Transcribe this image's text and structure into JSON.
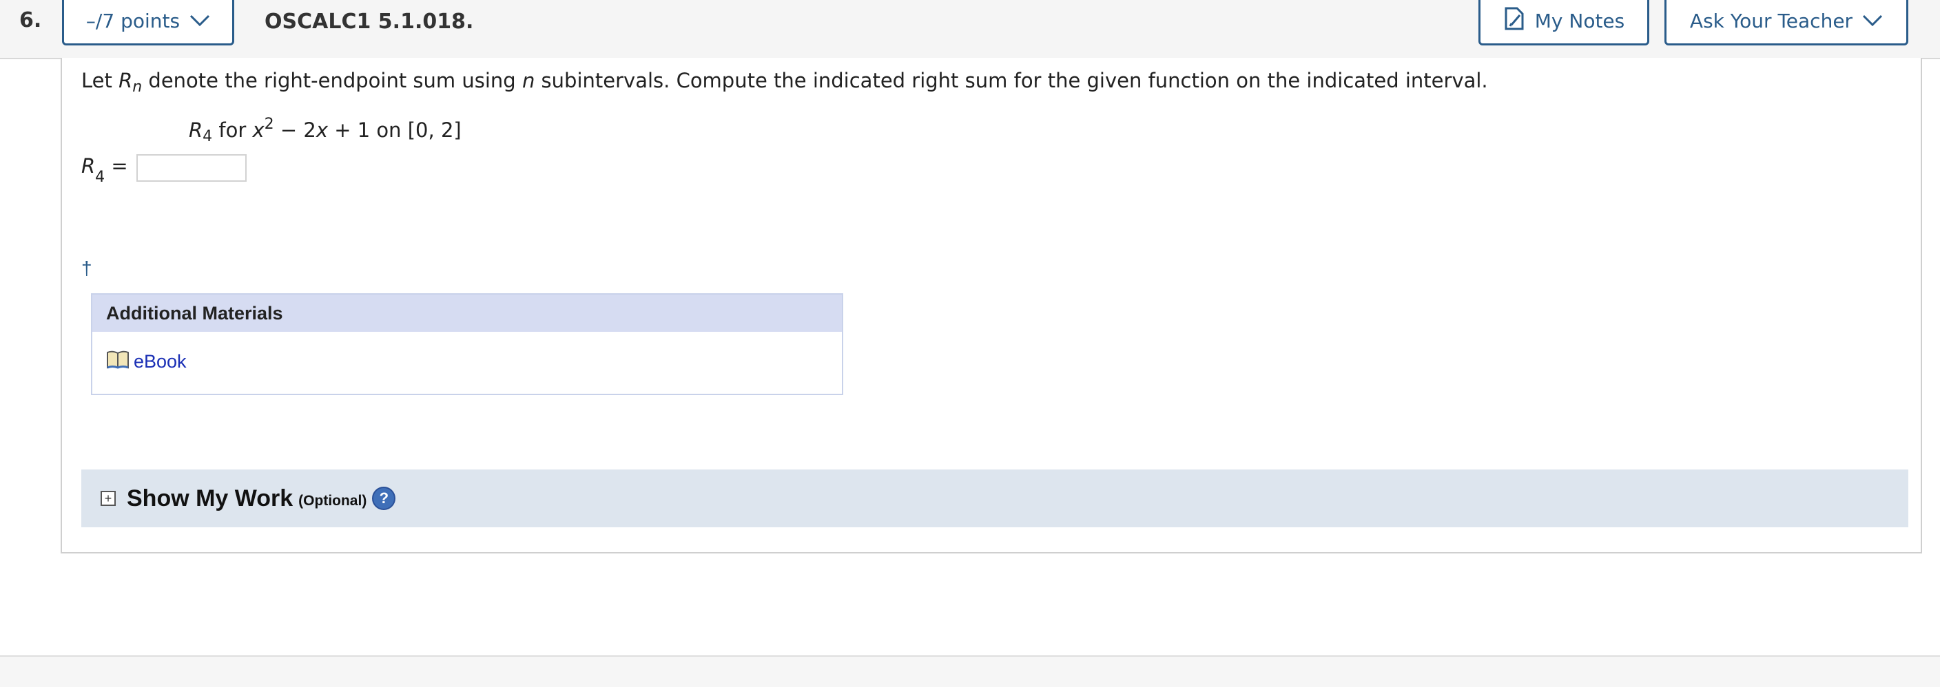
{
  "question": {
    "number": "6.",
    "points_label": "–/7 points",
    "id": "OSCALC1 5.1.018."
  },
  "toolbar": {
    "notes_label": "My Notes",
    "ask_label": "Ask Your Teacher"
  },
  "body": {
    "stem_pre": "Let ",
    "stem_R": "R",
    "stem_n": "n",
    "stem_mid": " denote the right-endpoint sum using ",
    "stem_n2": "n",
    "stem_post": " subintervals. Compute the indicated right sum for the given function on the indicated interval.",
    "math_R": "R",
    "math_sub": "4",
    "math_for": " for ",
    "math_x": "x",
    "math_exp": "2",
    "math_rest1": " − 2",
    "math_x2": "x",
    "math_rest2": " + 1 on [0, 2]",
    "answer_R": "R",
    "answer_sub": "4",
    "answer_eq": " =",
    "answer_value": "",
    "dagger": "†"
  },
  "materials": {
    "title": "Additional Materials",
    "link": "eBook"
  },
  "show_work": {
    "title": "Show My Work",
    "optional": "(Optional)",
    "help": "?"
  },
  "colors": {
    "accent": "#2a5c8a",
    "link": "#1a2fb5",
    "materials_header": "#d6dcf2",
    "show_work_bg": "#dde5ee"
  }
}
